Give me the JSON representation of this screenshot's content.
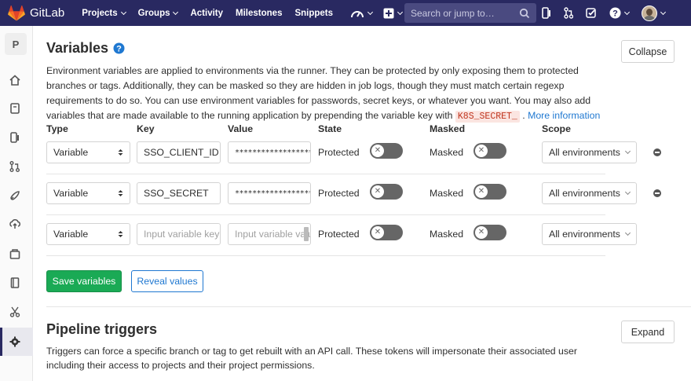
{
  "navbar": {
    "brand": "GitLab",
    "items": [
      {
        "label": "Projects",
        "dropdown": true
      },
      {
        "label": "Groups",
        "dropdown": true
      },
      {
        "label": "Activity",
        "dropdown": false
      },
      {
        "label": "Milestones",
        "dropdown": false
      },
      {
        "label": "Snippets",
        "dropdown": false
      }
    ],
    "search_placeholder": "Search or jump to…",
    "bg_color": "#292961"
  },
  "sidebar": {
    "project_letter": "P",
    "icons": [
      "home-icon",
      "repository-icon",
      "issues-icon",
      "merge-requests-icon",
      "rocket-icon",
      "operations-icon",
      "packages-icon",
      "wiki-icon",
      "snippets-icon",
      "settings-icon"
    ],
    "active": "settings-icon"
  },
  "variables": {
    "title": "Variables",
    "collapse_label": "Collapse",
    "description_part1": "Environment variables are applied to environments via the runner. They can be protected by only exposing them to protected branches or tags. Additionally, they can be masked so they are hidden in job logs, though they must match certain regexp requirements to do so. You can use environment variables for passwords, secret keys, or whatever you want. You may also add variables that are made available to the running application by prepending the variable key with ",
    "description_code": "K8S_SECRET_",
    "description_part2": " . ",
    "more_info_link": "More information",
    "columns": {
      "type": "Type",
      "key": "Key",
      "value": "Value",
      "state": "State",
      "masked": "Masked",
      "scope": "Scope"
    },
    "rows": [
      {
        "type": "Variable",
        "key": "SSO_CLIENT_ID",
        "key_placeholder": "",
        "value": "******************",
        "value_placeholder": "",
        "state_label": "Protected",
        "masked_label": "Masked",
        "scope": "All environments",
        "removable": true
      },
      {
        "type": "Variable",
        "key": "SSO_SECRET",
        "key_placeholder": "",
        "value": "******************",
        "value_placeholder": "",
        "state_label": "Protected",
        "masked_label": "Masked",
        "scope": "All environments",
        "removable": true
      },
      {
        "type": "Variable",
        "key": "",
        "key_placeholder": "Input variable key",
        "value": "",
        "value_placeholder": "Input variable value",
        "state_label": "Protected",
        "masked_label": "Masked",
        "scope": "All environments",
        "removable": false
      }
    ],
    "save_label": "Save variables",
    "reveal_label": "Reveal values"
  },
  "pipeline_triggers": {
    "title": "Pipeline triggers",
    "expand_label": "Expand",
    "description": "Triggers can force a specific branch or tag to get rebuilt with an API call. These tokens will impersonate their associated user including their access to projects and their project permissions."
  },
  "colors": {
    "primary_link": "#1f78d1",
    "save_green": "#1aaa55",
    "code_red": "#c0341d"
  }
}
